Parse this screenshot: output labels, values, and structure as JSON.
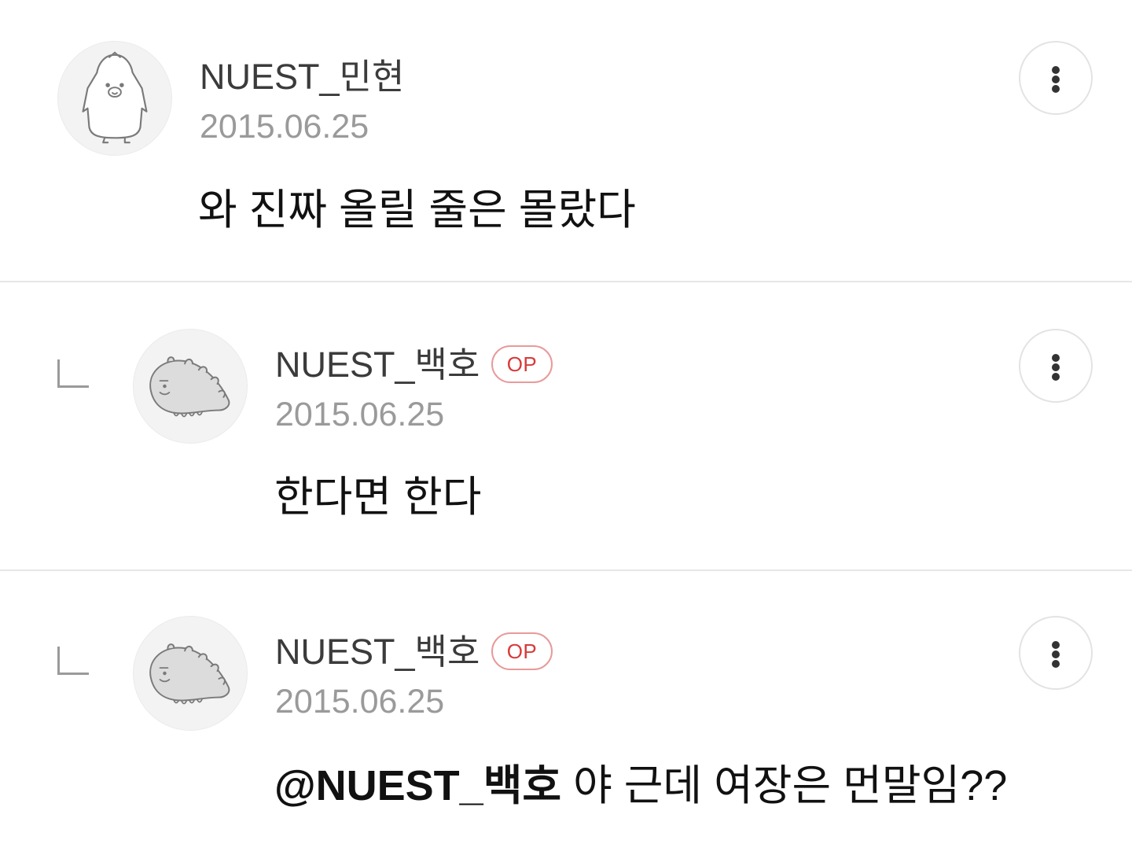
{
  "comments": [
    {
      "username": "NUEST_민현",
      "date": "2015.06.25",
      "is_op": false,
      "op_label": "",
      "mention": "",
      "text": "와 진짜 올릴 줄은 몰랐다",
      "avatar_icon": "penguin-avatar-icon"
    },
    {
      "username": "NUEST_백호",
      "date": "2015.06.25",
      "is_op": true,
      "op_label": "OP",
      "mention": "",
      "text": "한다면 한다",
      "avatar_icon": "dinosaur-avatar-icon"
    },
    {
      "username": "NUEST_백호",
      "date": "2015.06.25",
      "is_op": true,
      "op_label": "OP",
      "mention": "@NUEST_백호",
      "text": " 야 근데 여장은 먼말임??",
      "avatar_icon": "dinosaur-avatar-icon"
    }
  ],
  "colors": {
    "op_badge": "#d83a3a",
    "username": "#3b3b3b",
    "date": "#9a9a9a",
    "divider": "#e6e6e6"
  },
  "icons": [
    "more-options-icon",
    "reply-indent-icon"
  ]
}
